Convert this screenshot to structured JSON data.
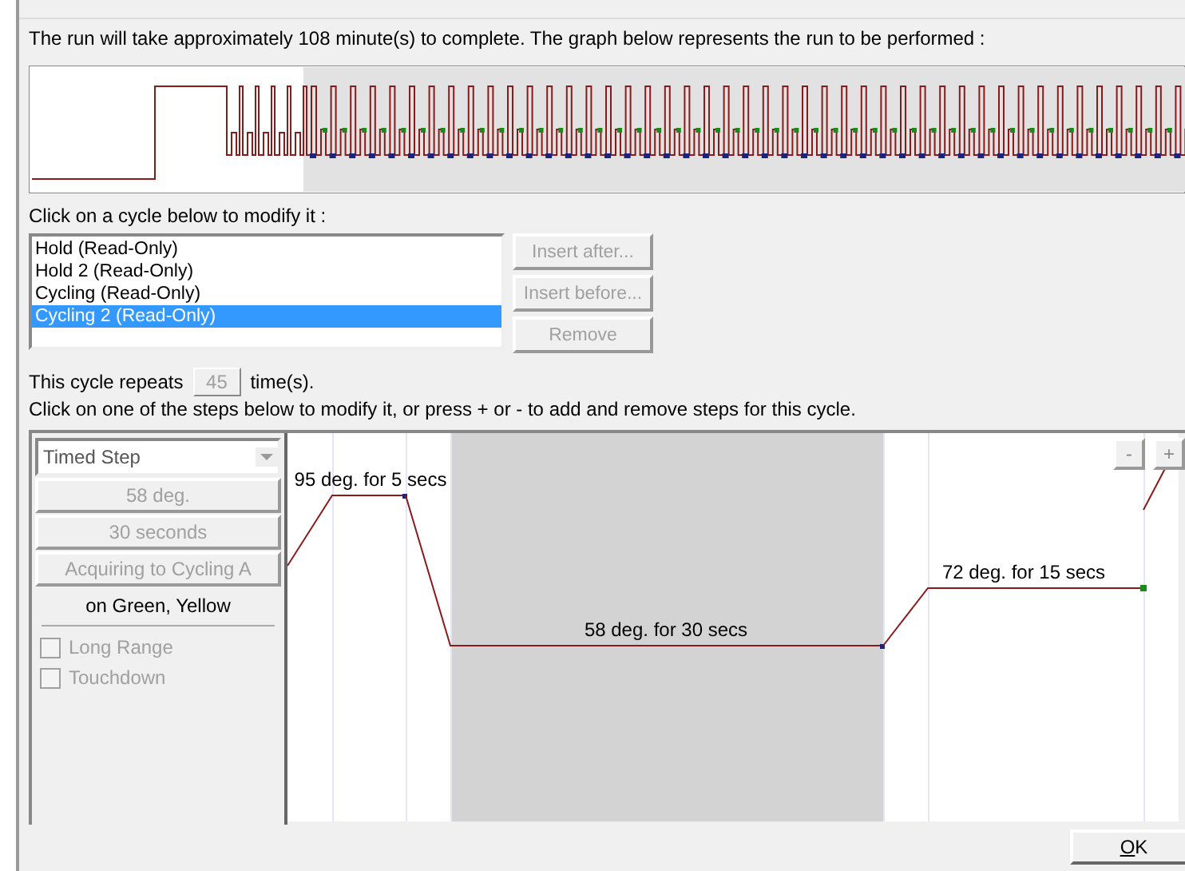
{
  "run_summary": "The run will take approximately 108 minute(s) to complete. The graph below represents the run to be performed :",
  "cycle_prompt": "Click on a cycle below to modify it :",
  "cycles": [
    {
      "label": "Hold (Read-Only)",
      "selected": false
    },
    {
      "label": "Hold 2 (Read-Only)",
      "selected": false
    },
    {
      "label": "Cycling (Read-Only)",
      "selected": false
    },
    {
      "label": "Cycling 2 (Read-Only)",
      "selected": true
    }
  ],
  "cycle_buttons": [
    {
      "label": "Insert after...",
      "disabled": true
    },
    {
      "label": "Insert before...",
      "disabled": true
    },
    {
      "label": "Remove",
      "disabled": true
    }
  ],
  "repeats": {
    "prefix": "This cycle repeats",
    "value": "45",
    "suffix": "time(s).",
    "disabled": true
  },
  "steps_prompt": "Click on one of the steps below to modify it, or press + or - to add and remove steps for this cycle.",
  "step_editor": {
    "type": "Timed Step",
    "temperature": "58 deg.",
    "duration": "30 seconds",
    "acquire": "Acquiring to Cycling A",
    "disabled": true,
    "acquire_channels": "on Green, Yellow",
    "options": [
      {
        "label": "Long Range",
        "checked": false,
        "disabled": true
      },
      {
        "label": "Touchdown",
        "checked": false,
        "disabled": true
      }
    ]
  },
  "steps": [
    {
      "label": "95 deg. for 5 secs",
      "selected": false,
      "acquire": false
    },
    {
      "label": "58 deg. for 30 secs",
      "selected": true,
      "acquire": false
    },
    {
      "label": "72 deg. for 15 secs",
      "selected": false,
      "acquire": true
    }
  ],
  "step_buttons": [
    {
      "label": "-"
    },
    {
      "label": "+"
    }
  ],
  "ok_button": "OK"
}
